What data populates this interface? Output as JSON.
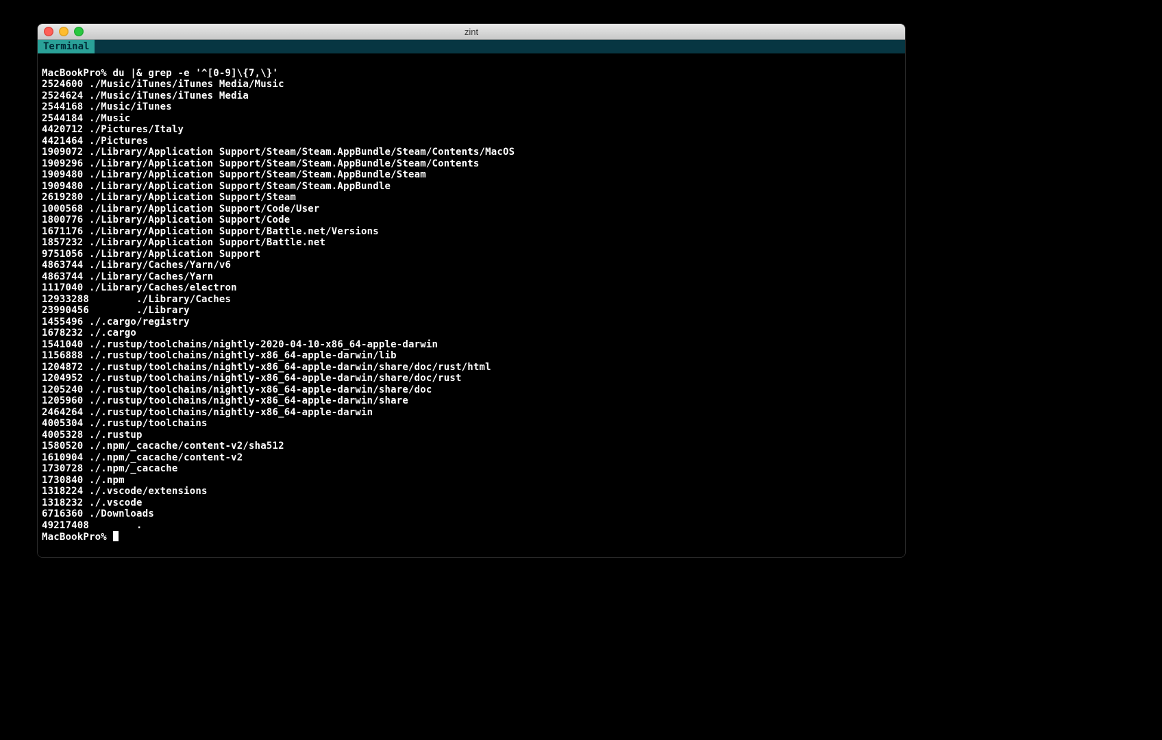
{
  "window": {
    "title": "zint"
  },
  "tabbar": {
    "tab_label": "Terminal"
  },
  "session": {
    "prompt": "MacBookPro% ",
    "command": "du |& grep -e '^[0-9]\\{7,\\}'",
    "output": [
      {
        "size": "2524600",
        "path": "./Music/iTunes/iTunes Media/Music"
      },
      {
        "size": "2524624",
        "path": "./Music/iTunes/iTunes Media"
      },
      {
        "size": "2544168",
        "path": "./Music/iTunes"
      },
      {
        "size": "2544184",
        "path": "./Music"
      },
      {
        "size": "4420712",
        "path": "./Pictures/Italy"
      },
      {
        "size": "4421464",
        "path": "./Pictures"
      },
      {
        "size": "1909072",
        "path": "./Library/Application Support/Steam/Steam.AppBundle/Steam/Contents/MacOS"
      },
      {
        "size": "1909296",
        "path": "./Library/Application Support/Steam/Steam.AppBundle/Steam/Contents"
      },
      {
        "size": "1909480",
        "path": "./Library/Application Support/Steam/Steam.AppBundle/Steam"
      },
      {
        "size": "1909480",
        "path": "./Library/Application Support/Steam/Steam.AppBundle"
      },
      {
        "size": "2619280",
        "path": "./Library/Application Support/Steam"
      },
      {
        "size": "1000568",
        "path": "./Library/Application Support/Code/User"
      },
      {
        "size": "1800776",
        "path": "./Library/Application Support/Code"
      },
      {
        "size": "1671176",
        "path": "./Library/Application Support/Battle.net/Versions"
      },
      {
        "size": "1857232",
        "path": "./Library/Application Support/Battle.net"
      },
      {
        "size": "9751056",
        "path": "./Library/Application Support"
      },
      {
        "size": "4863744",
        "path": "./Library/Caches/Yarn/v6"
      },
      {
        "size": "4863744",
        "path": "./Library/Caches/Yarn"
      },
      {
        "size": "1117040",
        "path": "./Library/Caches/electron"
      },
      {
        "size": "12933288",
        "path": "./Library/Caches",
        "wide": true
      },
      {
        "size": "23990456",
        "path": "./Library",
        "wide": true
      },
      {
        "size": "1455496",
        "path": "./.cargo/registry"
      },
      {
        "size": "1678232",
        "path": "./.cargo"
      },
      {
        "size": "1541040",
        "path": "./.rustup/toolchains/nightly-2020-04-10-x86_64-apple-darwin"
      },
      {
        "size": "1156888",
        "path": "./.rustup/toolchains/nightly-x86_64-apple-darwin/lib"
      },
      {
        "size": "1204872",
        "path": "./.rustup/toolchains/nightly-x86_64-apple-darwin/share/doc/rust/html"
      },
      {
        "size": "1204952",
        "path": "./.rustup/toolchains/nightly-x86_64-apple-darwin/share/doc/rust"
      },
      {
        "size": "1205240",
        "path": "./.rustup/toolchains/nightly-x86_64-apple-darwin/share/doc"
      },
      {
        "size": "1205960",
        "path": "./.rustup/toolchains/nightly-x86_64-apple-darwin/share"
      },
      {
        "size": "2464264",
        "path": "./.rustup/toolchains/nightly-x86_64-apple-darwin"
      },
      {
        "size": "4005304",
        "path": "./.rustup/toolchains"
      },
      {
        "size": "4005328",
        "path": "./.rustup"
      },
      {
        "size": "1580520",
        "path": "./.npm/_cacache/content-v2/sha512"
      },
      {
        "size": "1610904",
        "path": "./.npm/_cacache/content-v2"
      },
      {
        "size": "1730728",
        "path": "./.npm/_cacache"
      },
      {
        "size": "1730840",
        "path": "./.npm"
      },
      {
        "size": "1318224",
        "path": "./.vscode/extensions"
      },
      {
        "size": "1318232",
        "path": "./.vscode"
      },
      {
        "size": "6716360",
        "path": "./Downloads"
      },
      {
        "size": "49217408",
        "path": ".",
        "wide": true
      }
    ],
    "prompt2": "MacBookPro% "
  }
}
